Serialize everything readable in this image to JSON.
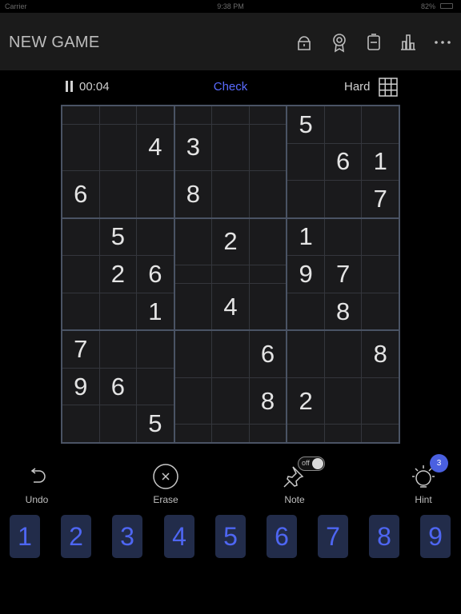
{
  "status_bar": {
    "carrier": "Carrier",
    "time": "9:38 PM",
    "battery": "82%"
  },
  "nav": {
    "title": "NEW GAME",
    "icons": [
      "cloud-lock-icon",
      "award-icon",
      "battery-icon",
      "stats-icon",
      "more-icon"
    ]
  },
  "info": {
    "timer": "00:04",
    "check_label": "Check",
    "difficulty": "Hard"
  },
  "board": {
    "rows": [
      [
        "",
        "",
        "",
        "",
        "",
        "",
        "5",
        "",
        ""
      ],
      [
        "",
        "",
        "4",
        "3",
        "",
        "",
        "",
        "6",
        "1"
      ],
      [
        "6",
        "",
        "",
        "8",
        "",
        "",
        "",
        "",
        "7"
      ],
      [
        "",
        "5",
        "",
        "",
        "2",
        "",
        "1",
        "",
        ""
      ],
      [
        "",
        "2",
        "6",
        "",
        "",
        "",
        "9",
        "7",
        ""
      ],
      [
        "",
        "",
        "1",
        "",
        "4",
        "",
        "",
        "8",
        ""
      ],
      [
        "7",
        "",
        "",
        "",
        "",
        "6",
        "",
        "",
        "8"
      ],
      [
        "9",
        "6",
        "",
        "",
        "",
        "8",
        "2",
        "",
        ""
      ],
      [
        "",
        "",
        "5",
        "",
        "",
        "",
        "",
        "",
        ""
      ]
    ]
  },
  "tools": {
    "undo": "Undo",
    "erase": "Erase",
    "note": "Note",
    "note_toggle": "off",
    "hint": "Hint",
    "hint_count": "3"
  },
  "numpad": [
    "1",
    "2",
    "3",
    "4",
    "5",
    "6",
    "7",
    "8",
    "9"
  ],
  "colors": {
    "accent": "#4e66f2",
    "key_bg": "#222c4a",
    "grid_line": "#4a5364",
    "badge": "#4a60e0"
  }
}
